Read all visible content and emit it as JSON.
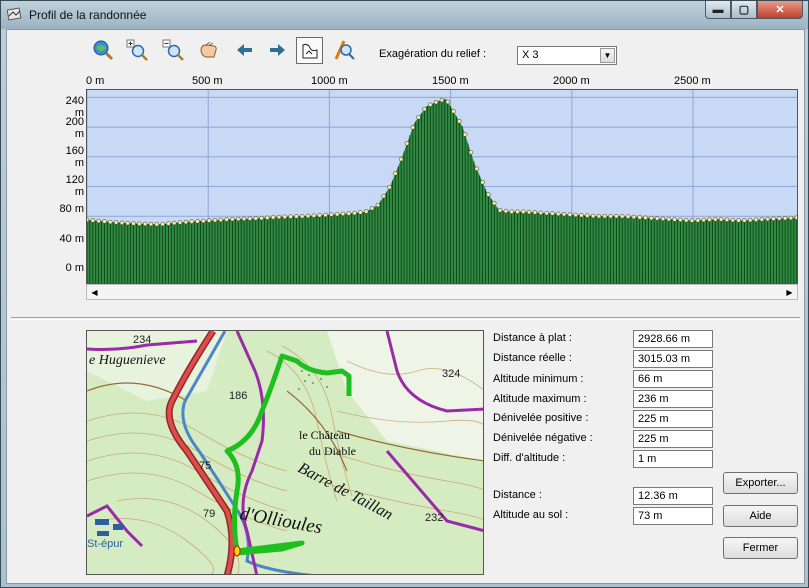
{
  "window": {
    "title": "Profil de la randonnée",
    "min_glyph": "▬",
    "max_glyph": "▢",
    "close_glyph": "✕"
  },
  "toolbar": {
    "icons": [
      "zoom-all-icon",
      "zoom-in-icon",
      "zoom-out-icon",
      "pan-hand-icon",
      "arrow-left-icon",
      "arrow-right-icon",
      "profile-mode-icon",
      "measure-icon"
    ],
    "exaggeration_label": "Exagération du relief :",
    "exaggeration_value": "X 3"
  },
  "profile": {
    "x_ticks": [
      "0 m",
      "500 m",
      "1000 m",
      "1500 m",
      "2000 m",
      "2500 m"
    ],
    "y_ticks": [
      "240 m",
      "200 m",
      "160 m",
      "120 m",
      "80 m",
      "40 m",
      "0 m"
    ],
    "colors": {
      "sky": "#c8d9f5",
      "ground": "#2e8b40",
      "edge": "#f5f0a0",
      "grid": "#8ea6d8"
    }
  },
  "chart_data": {
    "type": "area",
    "x": [
      0,
      100,
      200,
      300,
      400,
      500,
      600,
      700,
      800,
      900,
      1000,
      1100,
      1150,
      1200,
      1250,
      1300,
      1350,
      1400,
      1450,
      1480,
      1500,
      1550,
      1600,
      1650,
      1700,
      1750,
      1800,
      1900,
      2000,
      2100,
      2200,
      2300,
      2400,
      2500,
      2600,
      2700,
      2800,
      2929
    ],
    "y": [
      75,
      72,
      70,
      69,
      72,
      74,
      76,
      77,
      79,
      80,
      82,
      84,
      86,
      95,
      120,
      160,
      205,
      228,
      235,
      238,
      228,
      200,
      150,
      112,
      88,
      86,
      86,
      84,
      82,
      80,
      80,
      78,
      76,
      74,
      76,
      74,
      76,
      78
    ],
    "x_ticks": [
      "0 m",
      "500 m",
      "1000 m",
      "1500 m",
      "2000 m",
      "2500 m"
    ],
    "y_ticks": [
      "0 m",
      "40 m",
      "80 m",
      "120 m",
      "160 m",
      "200 m",
      "240 m"
    ],
    "xlim": [
      0,
      2929
    ],
    "ylim": [
      -10,
      250
    ],
    "grid": true
  },
  "map": {
    "labels": [
      "234",
      "e Huguenieve",
      "186",
      "324",
      "le Château",
      "du Diable",
      "Barre de Taillan",
      "75",
      "79",
      "d'Ollioules",
      "232",
      "St-épur"
    ]
  },
  "stats": [
    {
      "label": "Distance à plat :",
      "value": "2928.66 m"
    },
    {
      "label": "Distance réelle :",
      "value": "3015.03 m"
    },
    {
      "label": "Altitude minimum :",
      "value": "66 m"
    },
    {
      "label": "Altitude maximum :",
      "value": "236 m"
    },
    {
      "label": "Dénivelée positive :",
      "value": "225 m"
    },
    {
      "label": "Dénivelée négative :",
      "value": "225 m"
    },
    {
      "label": "Diff. d'altitude :",
      "value": "1 m"
    }
  ],
  "cursor": [
    {
      "label": "Distance :",
      "value": "12.36 m"
    },
    {
      "label": "Altitude au sol :",
      "value": "73 m"
    }
  ],
  "buttons": {
    "export": "Exporter...",
    "help": "Aide",
    "close": "Fermer"
  }
}
